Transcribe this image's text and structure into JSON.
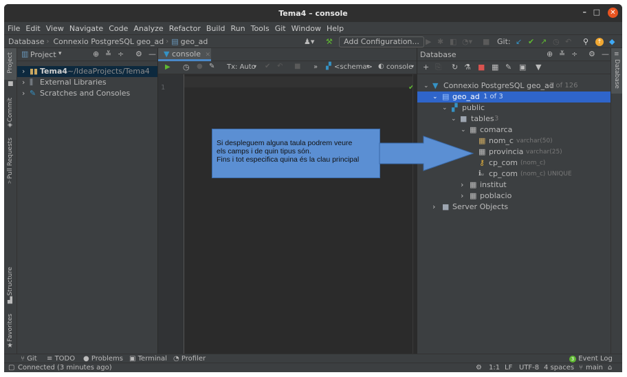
{
  "window": {
    "title": "Tema4 – console",
    "minimize": "–",
    "maximize": "□",
    "close": "✕"
  },
  "menu": [
    "File",
    "Edit",
    "View",
    "Navigate",
    "Code",
    "Analyze",
    "Refactor",
    "Build",
    "Run",
    "Tools",
    "Git",
    "Window",
    "Help"
  ],
  "breadcrumb": [
    "Database",
    "Connexio PostgreSQL geo_ad",
    "geo_ad"
  ],
  "toolbar": {
    "add_configuration": "Add Configuration...",
    "git_label": "Git:"
  },
  "left_stripe": {
    "project": "Project",
    "commit": "Commit",
    "pull_requests": "Pull Requests",
    "structure": "Structure",
    "favorites": "Favorites"
  },
  "right_stripe": {
    "database": "Database"
  },
  "project_panel": {
    "header": "Project",
    "tree": [
      {
        "name": "Tema4",
        "path": "~/IdeaProjects/Tema4"
      },
      {
        "name": "External Libraries"
      },
      {
        "name": "Scratches and Consoles"
      }
    ]
  },
  "editor": {
    "tab": "console",
    "tx_mode": "Tx: Auto",
    "schema": "<schema>",
    "session": "console",
    "line_numbers": [
      "1"
    ]
  },
  "database_panel": {
    "header": "Database",
    "tree": {
      "connection": {
        "name": "Connexio PostgreSQL geo_ad",
        "count": "1 of 126"
      },
      "database": {
        "name": "geo_ad",
        "count": "1 of 3"
      },
      "schema": "public",
      "tables": {
        "name": "tables",
        "count": "3"
      },
      "table_open": "comarca",
      "columns": [
        {
          "name": "nom_c",
          "type": "varchar(50)"
        },
        {
          "name": "provincia",
          "type": "varchar(25)"
        }
      ],
      "keys": [
        {
          "name": "cp_com",
          "detail": "(nom_c)"
        },
        {
          "name": "cp_com",
          "detail": "(nom_c) UNIQUE"
        }
      ],
      "other_tables": [
        "institut",
        "poblacio"
      ],
      "server_objects": "Server Objects"
    }
  },
  "callout": {
    "lines": [
      "Si despleguem alguna taula podrem veure",
      "els camps i de quin tipus són.",
      "Fins i tot especifica quina és la clau principal"
    ]
  },
  "tool_windows": [
    "Git",
    "TODO",
    "Problems",
    "Terminal",
    "Profiler"
  ],
  "event_log": {
    "badge": "3",
    "label": "Event Log"
  },
  "status": {
    "message": "Connected (3 minutes ago)",
    "position": "1:1",
    "line_sep": "LF",
    "encoding": "UTF-8",
    "indent": "4 spaces",
    "branch": "main"
  },
  "colors": {
    "accent": "#4a88c7",
    "callout_fill": "#5b8fd3",
    "close_button": "#e95420",
    "selection": "#2f65ca"
  }
}
